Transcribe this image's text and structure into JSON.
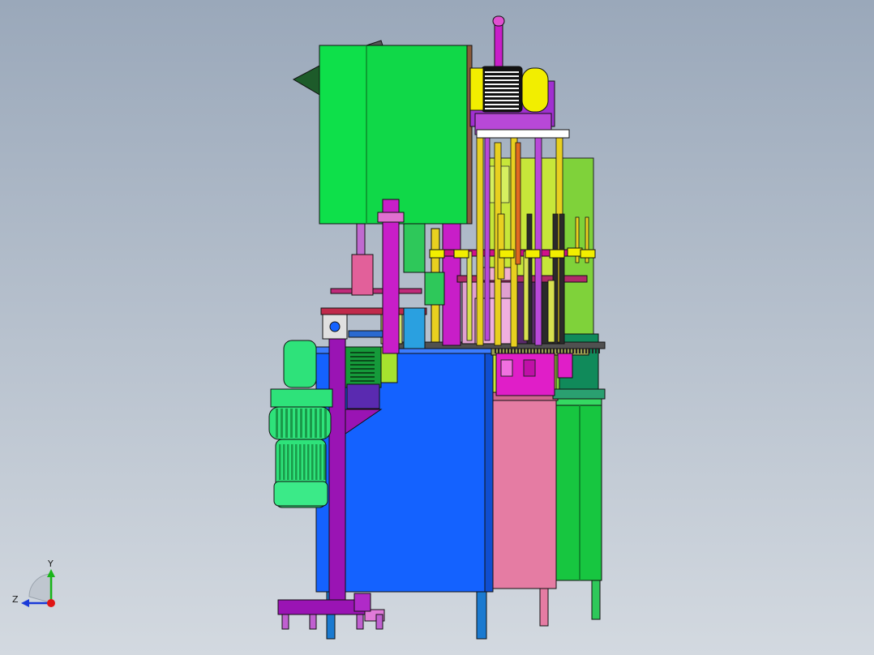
{
  "view": {
    "background_top": "#9aa8ba",
    "background_bottom": "#d3d9e0"
  },
  "triad": {
    "y_label": "Y",
    "z_label": "Z",
    "y_color": "#19b519",
    "z_color": "#1a3ad8",
    "x_dot_color": "#e01515"
  },
  "palette": {
    "frame_blue": "#1462ff",
    "pink_cabinet": "#e57ca3",
    "green_cabinet": "#17c640",
    "hopper_green": "#0ee04a",
    "motor_yellow": "#f2ee00",
    "purple_stand": "#9a14b4",
    "magenta": "#e01ec8",
    "lime": "#b5e23a",
    "motor_green": "#2ee27a"
  },
  "icons": [
    "coordinate-triad-icon"
  ]
}
